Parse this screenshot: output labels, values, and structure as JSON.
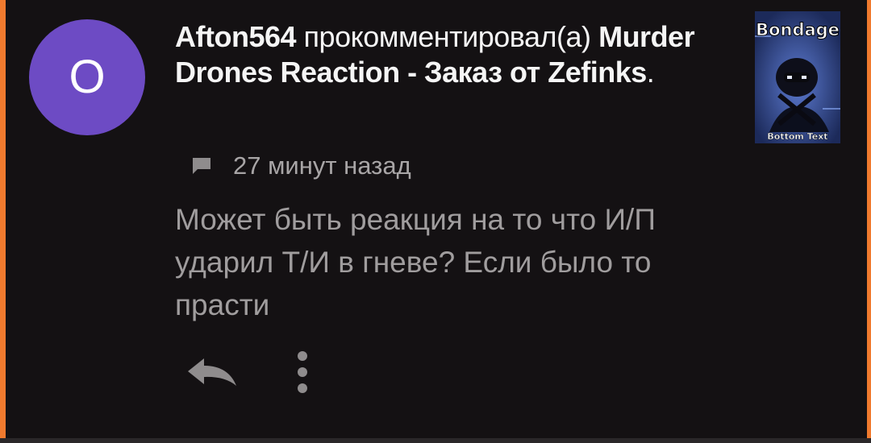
{
  "notification": {
    "avatar_letter": "O",
    "avatar_color": "#6d4bc4",
    "username": "Afton564",
    "action": "прокомментировал(а)",
    "post_title": "Murder Drones Reaction - Заказ от Zefinks",
    "title_end": ".",
    "time": "27 минут назад",
    "comment_text": "Может быть реакция на то что И/П ударил Т/И в гневе? Если было то прасти",
    "thumbnail": {
      "top_text": "Bondage",
      "bottom_text": "Bottom Text"
    }
  },
  "icons": {
    "comment": "comment-icon",
    "reply": "reply-icon",
    "more": "more-vertical-icon"
  },
  "colors": {
    "background": "#141113",
    "accent": "#f07a2e",
    "title": "#f5f5f5",
    "secondary": "#a8a5a6"
  }
}
